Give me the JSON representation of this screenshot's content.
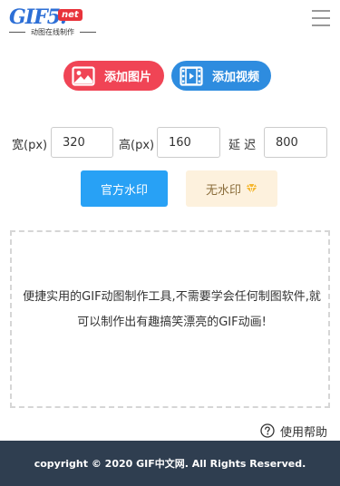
{
  "logo": {
    "main": "GIF5.",
    "badge": "net",
    "tagline": "动图在线制作"
  },
  "header": {
    "menu_icon": "hamburger-menu-icon"
  },
  "upload": {
    "add_image": {
      "label": "添加图片",
      "icon": "image-icon",
      "color": "#f04455"
    },
    "add_video": {
      "label": "添加视频",
      "icon": "film-icon",
      "color": "#2e8cdf"
    }
  },
  "settings": {
    "width": {
      "label": "宽(px)",
      "value": "320"
    },
    "height": {
      "label": "高(px)",
      "value": "160"
    },
    "delay": {
      "label": "延 迟",
      "value": "800"
    }
  },
  "watermark": {
    "official": {
      "label": "官方水印",
      "color": "#28a1f5"
    },
    "none": {
      "label": "无水印",
      "icon": "diamond-icon"
    }
  },
  "dropzone": {
    "text": "便捷实用的GIF动图制作工具,不需要学会任何制图软件,就可以制作出有趣搞笑漂亮的GIF动画!"
  },
  "help": {
    "label": "使用帮助",
    "icon": "question-circle-icon"
  },
  "footer": {
    "copyright": "copyright © 2020 GIF中文网. All Rights Reserved."
  }
}
